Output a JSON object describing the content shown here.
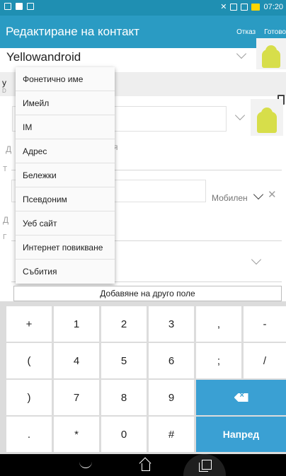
{
  "status_bar": {
    "time": "07:20"
  },
  "app_bar": {
    "title": "Редактиране на контакт",
    "cancel_label": "Отказ",
    "done_label": "Готово"
  },
  "contact": {
    "name": "Yellowandroid",
    "behind_popup_hint": "я",
    "phone_type": "Мобилен",
    "partial_labels": [
      "у",
      "D",
      "Д",
      "Т",
      "Д",
      "Г"
    ]
  },
  "add_field_menu": {
    "items": [
      "Фонетично име",
      "Имейл",
      "IM",
      "Адрес",
      "Бележки",
      "Псевдоним",
      "Уеб сайт",
      "Интернет повикване",
      "Събития"
    ]
  },
  "add_field_button": "Добавяне на друго поле",
  "keyboard": {
    "rows": [
      [
        "+",
        "1",
        "2",
        "3",
        ",",
        "-"
      ],
      [
        "(",
        "4",
        "5",
        "6",
        ";",
        "/"
      ],
      [
        ")",
        "7",
        "8",
        "9"
      ],
      [
        ".",
        "*",
        "0",
        "#"
      ]
    ],
    "next_label": "Напред"
  },
  "colors": {
    "status_bar": "#1f8fb2",
    "app_bar": "#2a9bc3",
    "key_accent": "#3aa0d3"
  },
  "icons": {
    "back": "back-icon",
    "home": "home-icon",
    "recent": "recent-apps-icon",
    "backspace": "backspace-icon",
    "delete": "trash-icon"
  }
}
